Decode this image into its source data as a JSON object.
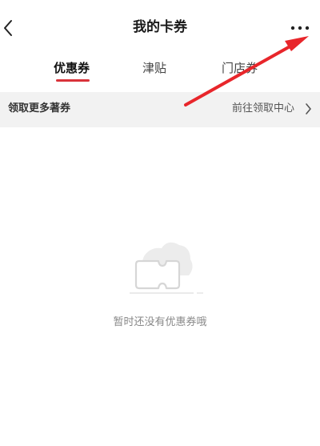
{
  "header": {
    "title": "我的卡券",
    "back_icon": "chevron-left-icon",
    "more_icon": "more-dots-icon"
  },
  "tabs": [
    {
      "label": "优惠券",
      "active": true
    },
    {
      "label": "津贴",
      "active": false
    },
    {
      "label": "门店券",
      "active": false
    }
  ],
  "promo": {
    "left_text": "领取更多著券",
    "right_text": "前往领取中心"
  },
  "empty_state": {
    "icon": "empty-coupon-icon",
    "message": "暂时还没有优惠券哦"
  },
  "colors": {
    "accent": "#d9333a",
    "annotation_arrow": "#e8262b",
    "promo_bg": "#f2f2f2"
  }
}
